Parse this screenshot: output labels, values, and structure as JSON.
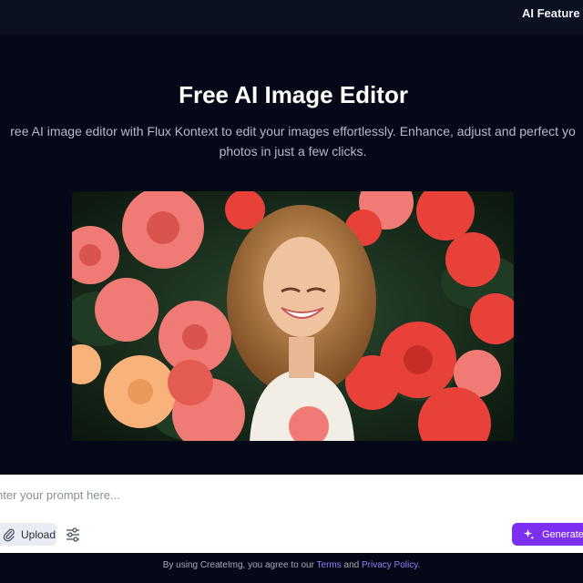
{
  "nav": {
    "link_label": "AI Feature"
  },
  "hero": {
    "title": "Free AI Image Editor",
    "subtitle_line1": "ree AI image editor with Flux Kontext to edit your images effortlessly. Enhance, adjust and perfect yo",
    "subtitle_line2": "photos in just a few clicks."
  },
  "preview": {
    "palette": {
      "flower_red": "#e8413a",
      "flower_pink": "#f07a74",
      "flower_peach": "#f9b37a",
      "foliage": "#1f3b24"
    }
  },
  "prompt": {
    "placeholder": "nter your prompt here...",
    "value": ""
  },
  "toolbar": {
    "upload_label": "Upload",
    "upload_icon": "paperclip-icon",
    "settings_icon": "sliders-icon",
    "generate_label": "Generate",
    "generate_icon": "sparkle-icon"
  },
  "footer": {
    "text_prefix": "By using CreateImg, you agree to our",
    "terms_label": "Terms",
    "and_text": "and",
    "privacy_label": "Privacy Policy",
    "end": "."
  },
  "colors": {
    "background": "#050816",
    "topbar": "#0c1122",
    "accent": "#7c2ff0",
    "link": "#8f83ff"
  }
}
